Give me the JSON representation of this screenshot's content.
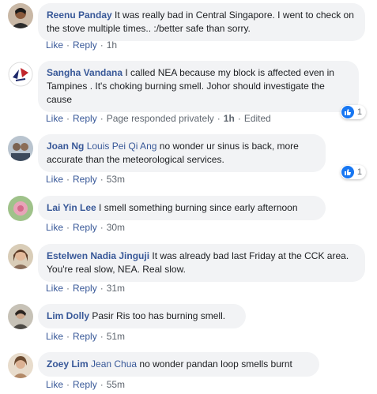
{
  "comments": [
    {
      "name": "Reenu Panday",
      "tag": "",
      "text": "It was really bad in Central Singapore. I went to check on the stove multiple times.. :/better safe than sorry.",
      "like": "Like",
      "reply": "Reply",
      "extra": "",
      "time": "1h",
      "edited": "",
      "reactions": ""
    },
    {
      "name": "Sangha Vandana",
      "tag": "",
      "text": "I called NEA because my block is affected even in Tampines . It's choking burning smell. Johor should investigate the cause",
      "like": "Like",
      "reply": "Reply",
      "extra": "Page responded privately",
      "time": "1h",
      "edited": "Edited",
      "reactions": "1"
    },
    {
      "name": "Joan Ng",
      "tag": "Louis Pei Qi Ang",
      "text": "no wonder ur sinus is back, more accurate than the meteorological services.",
      "like": "Like",
      "reply": "Reply",
      "extra": "",
      "time": "53m",
      "edited": "",
      "reactions": "1"
    },
    {
      "name": "Lai Yin Lee",
      "tag": "",
      "text": "I smell something burning since early afternoon",
      "like": "Like",
      "reply": "Reply",
      "extra": "",
      "time": "30m",
      "edited": "",
      "reactions": ""
    },
    {
      "name": "Estelwen Nadia Jinguji",
      "tag": "",
      "text": "It was already bad last Friday at the CCK area. You're real slow, NEA. Real slow.",
      "like": "Like",
      "reply": "Reply",
      "extra": "",
      "time": "31m",
      "edited": "",
      "reactions": ""
    },
    {
      "name": "Lim Dolly",
      "tag": "",
      "text": "Pasir Ris too has burning smell.",
      "like": "Like",
      "reply": "Reply",
      "extra": "",
      "time": "51m",
      "edited": "",
      "reactions": ""
    },
    {
      "name": "Zoey Lim",
      "tag": "Jean Chua",
      "text": "no wonder pandan loop smells burnt",
      "like": "Like",
      "reply": "Reply",
      "extra": "",
      "time": "55m",
      "edited": "",
      "reactions": ""
    }
  ],
  "colors": {
    "link": "#385898",
    "bubble": "#f2f3f5",
    "meta": "#606770",
    "like_badge": "#1877f2"
  }
}
